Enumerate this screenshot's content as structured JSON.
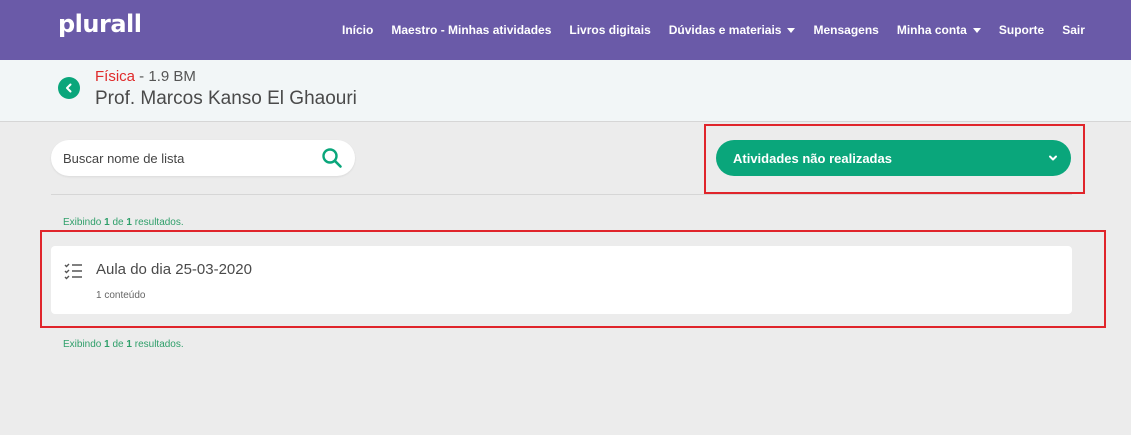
{
  "header": {
    "logo": "plurall",
    "nav": [
      {
        "label": "Início",
        "has_caret": false
      },
      {
        "label": "Maestro - Minhas atividades",
        "has_caret": false
      },
      {
        "label": "Livros digitais",
        "has_caret": false
      },
      {
        "label": "Dúvidas e materiais",
        "has_caret": true
      },
      {
        "label": "Mensagens",
        "has_caret": false
      },
      {
        "label": "Minha conta",
        "has_caret": true
      },
      {
        "label": "Suporte",
        "has_caret": false
      },
      {
        "label": "Sair",
        "has_caret": false
      }
    ]
  },
  "subheader": {
    "subject": "Física",
    "class_suffix": " - 1.9 BM",
    "teacher": "Prof. Marcos Kanso El Ghaouri"
  },
  "search": {
    "placeholder": "Buscar nome de lista",
    "value": ""
  },
  "filter": {
    "selected": "Atividades não realizadas"
  },
  "results": {
    "prefix": "Exibindo",
    "shown": "1",
    "de": "de",
    "total": "1",
    "suffix": "resultados."
  },
  "lists": [
    {
      "title": "Aula do dia 25-03-2020",
      "subtitle": "1 conteúdo"
    }
  ],
  "colors": {
    "topbar": "#6a5aa8",
    "accent_green": "#0aa67b",
    "subject_red": "#e02a2a",
    "highlight_red": "#e0252b"
  },
  "icons": [
    "back-arrow-icon",
    "search-icon",
    "chevron-down-icon",
    "checklist-icon",
    "caret-down-icon"
  ]
}
